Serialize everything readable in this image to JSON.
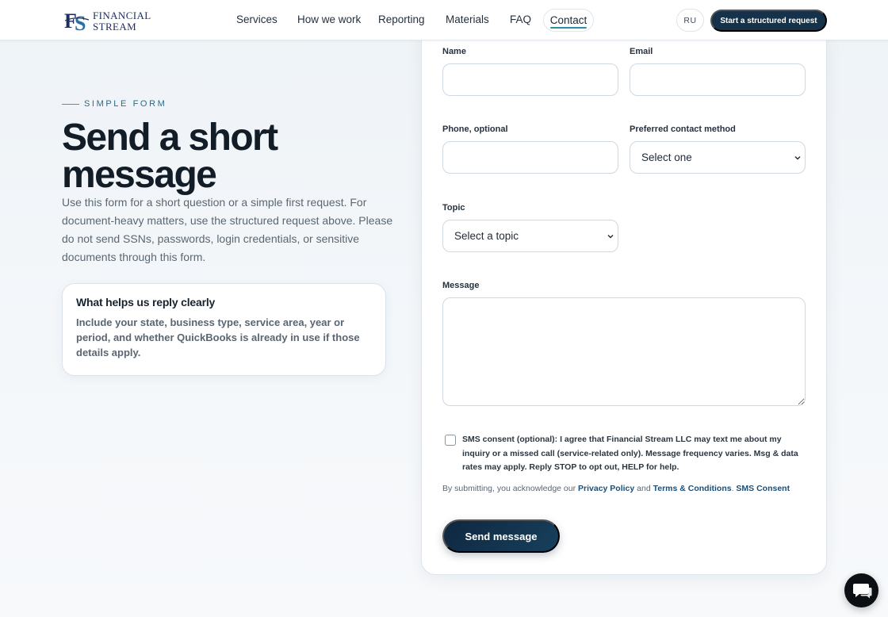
{
  "header": {
    "logo": {
      "monogram": "FS",
      "line1": "FINANCIAL",
      "line2": "STREAM"
    },
    "nav": [
      {
        "label": "Services"
      },
      {
        "label": "How we work"
      },
      {
        "label": "Reporting"
      },
      {
        "label": "Materials"
      },
      {
        "label": "FAQ"
      },
      {
        "label": "Contact",
        "active": true
      }
    ],
    "lang_label": "RU",
    "cta_label": "Start a structured request"
  },
  "intro": {
    "eyebrow": "SIMPLE FORM",
    "title": "Send a short message",
    "description": "Use this form for a short question or a simple first request. For document-heavy matters, use the structured request above. Please do not send SSNs, passwords, login credentials, or sensitive documents through this form."
  },
  "tip": {
    "title": "What helps us reply clearly",
    "body": "Include your state, business type, service area, year or period, and whether QuickBooks is already in use if those details apply."
  },
  "form": {
    "name_label": "Name",
    "name_value": "",
    "email_label": "Email",
    "email_value": "",
    "phone_label": "Phone, optional",
    "phone_value": "",
    "contact_method_label": "Preferred contact method",
    "contact_method_value": "Select one",
    "topic_label": "Topic",
    "topic_value": "Select a topic",
    "message_label": "Message",
    "message_value": "",
    "consent_checked": false,
    "consent_text": "SMS consent (optional): I agree that Financial Stream LLC may text me about my inquiry or a missed call (service-related only). Message frequency varies. Msg & data rates may apply. Reply STOP to opt out, HELP for help.",
    "legal": {
      "prefix": "By submitting, you acknowledge our ",
      "privacy_link": "Privacy Policy",
      "and": " and ",
      "terms_link": "Terms & Conditions",
      "sep": ". ",
      "sms_link": "SMS Consent"
    },
    "submit_label": "Send message"
  },
  "chat": {
    "icon": "chat-bubble-icon"
  },
  "colors": {
    "brand_navy": "#15324a",
    "accent_teal": "#2b8fa8",
    "link": "#1f4e74"
  }
}
